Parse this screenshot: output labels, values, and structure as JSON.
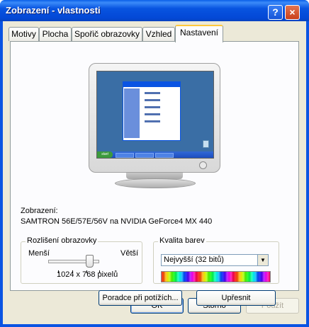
{
  "window": {
    "title": "Zobrazení - vlastnosti",
    "help_label": "?",
    "close_label": "×"
  },
  "tabs": [
    {
      "label": "Motivy"
    },
    {
      "label": "Plocha"
    },
    {
      "label": "Spořič obrazovky"
    },
    {
      "label": "Vzhled"
    },
    {
      "label": "Nastavení",
      "active": true
    }
  ],
  "preview": {
    "taskbar_start": "start"
  },
  "display": {
    "label": "Zobrazení:",
    "device": "SAMTRON 56E/57E/56V na NVIDIA GeForce4 MX 440"
  },
  "resolution": {
    "group_label": "Rozlišení obrazovky",
    "less_label": "Menší",
    "more_label": "Větší",
    "value_text": "1024 x 768 pixelů"
  },
  "color_quality": {
    "group_label": "Kvalita barev",
    "selected": "Nejvyšší (32 bitů)"
  },
  "buttons": {
    "troubleshoot": "Poradce při potížích...",
    "advanced": "Upřesnit",
    "ok": "OK",
    "cancel": "Storno",
    "apply": "Použít"
  }
}
